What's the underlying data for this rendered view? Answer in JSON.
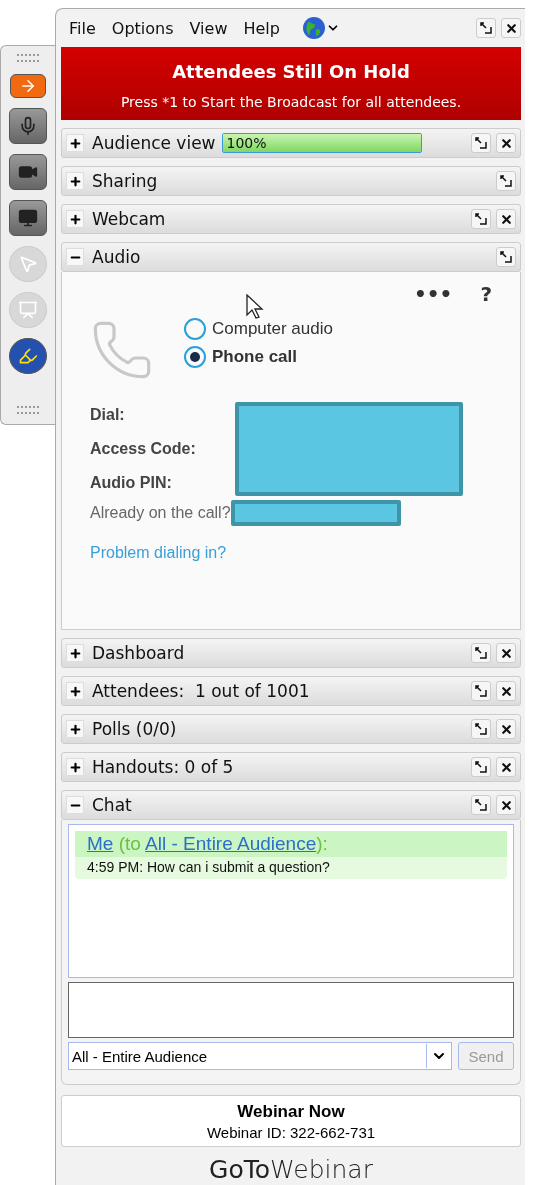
{
  "menu": [
    "File",
    "Options",
    "View",
    "Help"
  ],
  "banner": {
    "title": "Attendees Still On Hold",
    "message": "Press *1 to Start the Broadcast for all attendees."
  },
  "toolbar": [
    {
      "kind": "arrow",
      "selected": true,
      "disabled": false
    },
    {
      "kind": "mic",
      "selected": false,
      "disabled": false
    },
    {
      "kind": "webcam",
      "selected": false,
      "disabled": false
    },
    {
      "kind": "screen",
      "selected": false,
      "disabled": false
    },
    {
      "kind": "pointer",
      "selected": false,
      "disabled": true
    },
    {
      "kind": "share",
      "selected": false,
      "disabled": true
    },
    {
      "kind": "draw",
      "selected": false,
      "disabled": false
    }
  ],
  "panels_top": [
    {
      "title": "Audience view",
      "expanded": false,
      "closable": true,
      "level": 1,
      "reading": "100%"
    },
    {
      "title": "Sharing",
      "expanded": false,
      "closable": false
    },
    {
      "title": "Webcam",
      "expanded": false,
      "closable": true
    },
    {
      "title": "Audio",
      "expanded": true,
      "closable": false
    }
  ],
  "audio": {
    "more": "•••",
    "help": "?",
    "options": [
      {
        "label": "Computer audio",
        "selected": false
      },
      {
        "label": "Phone call",
        "selected": true
      }
    ],
    "fields": [
      "Dial:",
      "Access Code:",
      "Audio PIN:"
    ],
    "already": "Already on the call?",
    "problem_link": "Problem dialing in?"
  },
  "panels_bottom": [
    {
      "title": "Dashboard",
      "expanded": false,
      "closable": true
    },
    {
      "title": "Attendees:  1 out of 1001",
      "expanded": false,
      "closable": true
    },
    {
      "title": "Polls (0/0)",
      "expanded": false,
      "closable": true
    },
    {
      "title": "Handouts: 0 of 5",
      "expanded": false,
      "closable": true
    },
    {
      "title": "Chat",
      "expanded": true,
      "closable": true
    }
  ],
  "chat": {
    "messages": [
      {
        "sender": "Me",
        "prefix": "(to",
        "recipient": "All - Entire Audience",
        "suffix": "):",
        "text": "4:59 PM: How can i submit a question?"
      }
    ],
    "recipient": "All - Entire Audience",
    "send": "Send"
  },
  "footer": {
    "title": "Webinar Now",
    "id": "Webinar ID: 322-662-731",
    "logo": "**GoTo**Webinar"
  }
}
